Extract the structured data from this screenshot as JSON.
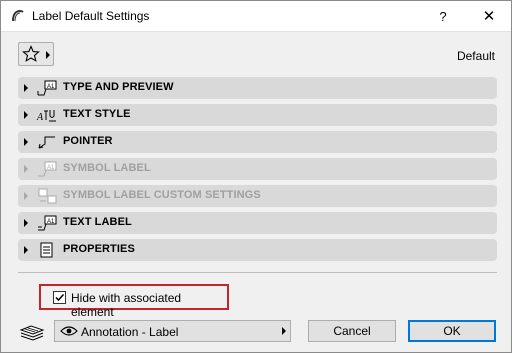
{
  "window": {
    "title": "Label Default Settings",
    "help_label": "?",
    "close_label": "✕"
  },
  "favorites": {
    "preset_label": "Default"
  },
  "panels": [
    {
      "label": "TYPE AND PREVIEW",
      "enabled": true,
      "icon": "label-preview-icon"
    },
    {
      "label": "TEXT STYLE",
      "enabled": true,
      "icon": "text-style-icon"
    },
    {
      "label": "POINTER",
      "enabled": true,
      "icon": "pointer-icon"
    },
    {
      "label": "SYMBOL LABEL",
      "enabled": false,
      "icon": "symbol-label-icon"
    },
    {
      "label": "SYMBOL LABEL CUSTOM SETTINGS",
      "enabled": false,
      "icon": "symbol-custom-icon"
    },
    {
      "label": "TEXT LABEL",
      "enabled": true,
      "icon": "text-label-icon"
    },
    {
      "label": "PROPERTIES",
      "enabled": true,
      "icon": "properties-icon"
    }
  ],
  "options": {
    "hide_label": "Hide with associated element",
    "hide_checked": true
  },
  "footer": {
    "view_label": "Annotation - Label",
    "cancel_label": "Cancel",
    "ok_label": "OK"
  },
  "colors": {
    "highlight_border": "#c0262c",
    "ok_border": "#0078d7"
  }
}
